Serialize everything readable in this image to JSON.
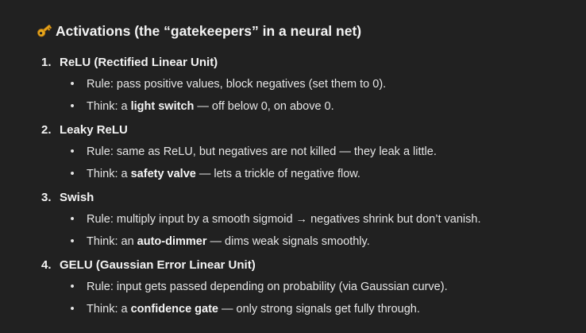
{
  "heading": {
    "icon": "key-icon",
    "text": "Activations (the “gatekeepers” in a neural net)"
  },
  "items": [
    {
      "number": "1.",
      "title": "ReLU (Rectified Linear Unit)",
      "rule": "Rule: pass positive values, block negatives (set them to 0).",
      "think_prefix": "Think: a ",
      "think_bold": "light switch",
      "think_suffix": " — off below 0, on above 0."
    },
    {
      "number": "2.",
      "title": "Leaky ReLU",
      "rule": "Rule: same as ReLU, but negatives are not killed — they leak a little.",
      "think_prefix": "Think: a ",
      "think_bold": "safety valve",
      "think_suffix": " — lets a trickle of negative flow."
    },
    {
      "number": "3.",
      "title": "Swish",
      "rule": "Rule: multiply input by a smooth sigmoid → negatives shrink but don’t vanish.",
      "think_prefix": "Think: an ",
      "think_bold": "auto-dimmer",
      "think_suffix": " — dims weak signals smoothly."
    },
    {
      "number": "4.",
      "title": "GELU (Gaussian Error Linear Unit)",
      "rule": "Rule: input gets passed depending on probability (via Gaussian curve).",
      "think_prefix": "Think: a ",
      "think_bold": "confidence gate",
      "think_suffix": " — only strong signals get fully through."
    }
  ]
}
